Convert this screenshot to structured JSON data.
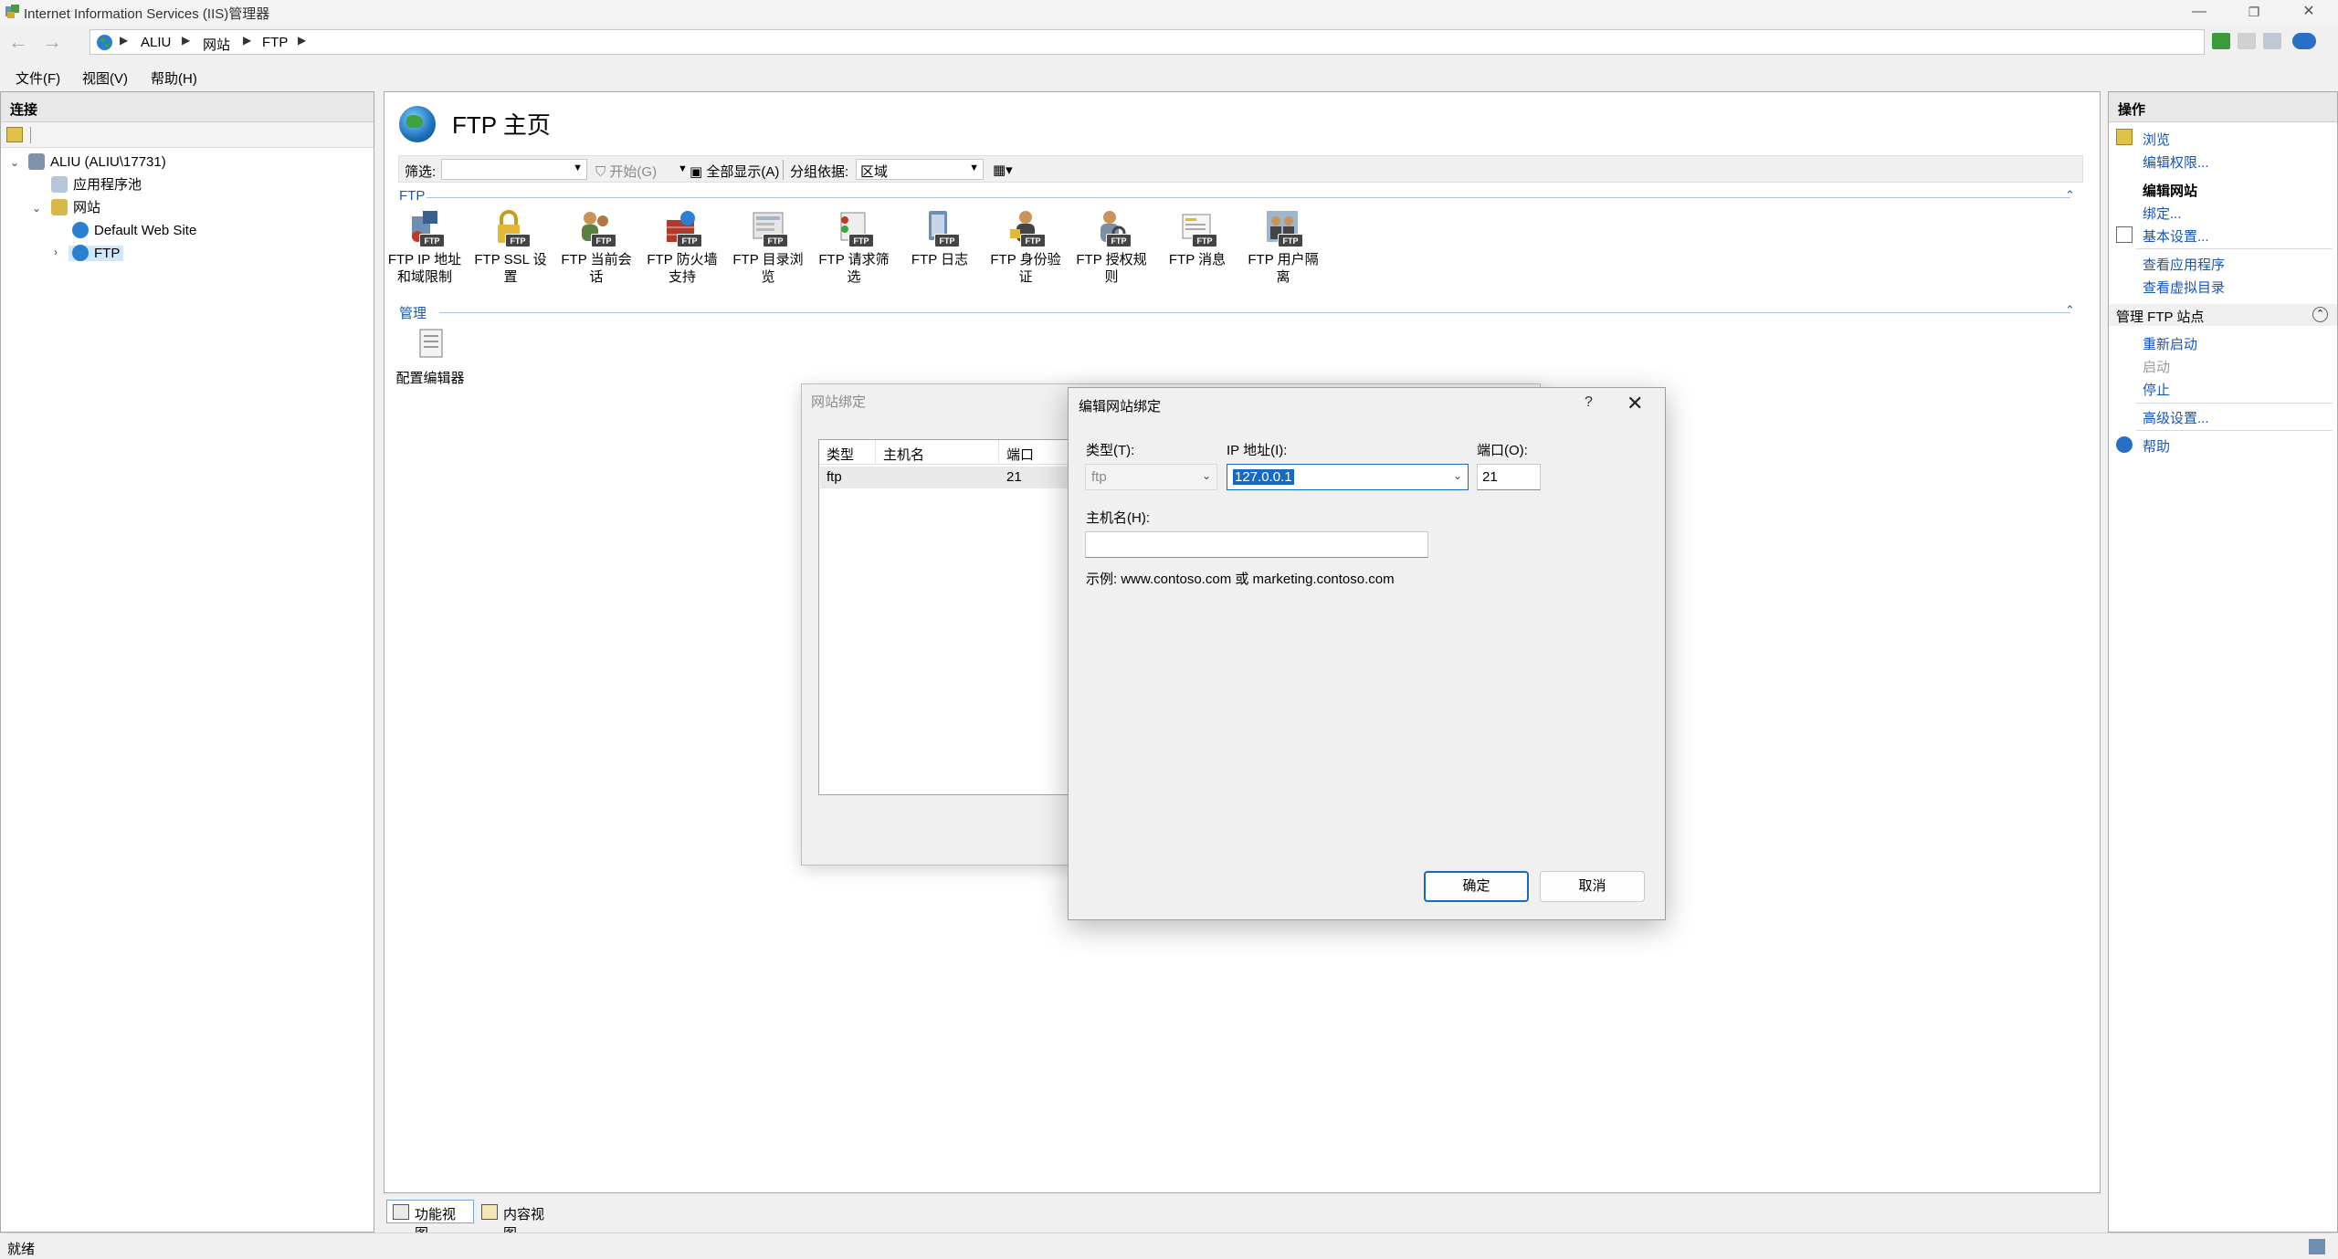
{
  "window": {
    "title": "Internet Information Services (IIS)管理器",
    "minimize_glyph": "—",
    "restore_glyph": "❐",
    "close_glyph": "✕"
  },
  "address": {
    "crumbs": [
      "ALIU",
      "网站",
      "FTP"
    ]
  },
  "menu": {
    "items": [
      "文件(F)",
      "视图(V)",
      "帮助(H)"
    ]
  },
  "left_panel": {
    "header": "连接",
    "tree": {
      "server": "ALIU (ALIU\\17731)",
      "app_pools": "应用程序池",
      "sites": "网站",
      "default_site": "Default Web Site",
      "ftp": "FTP"
    }
  },
  "center": {
    "title": "FTP 主页",
    "filter": {
      "label": "筛选:",
      "start": "开始(G)",
      "show_all": "全部显示(A)",
      "group_by_label": "分组依据:",
      "group_by_value": "区域"
    },
    "groups": {
      "ftp": "FTP",
      "manage": "管理"
    },
    "ftp_features": [
      {
        "line1": "FTP IP 地址",
        "line2": "和域限制"
      },
      {
        "line1": "FTP SSL 设",
        "line2": "置"
      },
      {
        "line1": "FTP 当前会",
        "line2": "话"
      },
      {
        "line1": "FTP 防火墙",
        "line2": "支持"
      },
      {
        "line1": "FTP 目录浏",
        "line2": "览"
      },
      {
        "line1": "FTP 请求筛",
        "line2": "选"
      },
      {
        "line1": "FTP 日志",
        "line2": ""
      },
      {
        "line1": "FTP 身份验",
        "line2": "证"
      },
      {
        "line1": "FTP 授权规",
        "line2": "则"
      },
      {
        "line1": "FTP 消息",
        "line2": ""
      },
      {
        "line1": "FTP 用户隔",
        "line2": "离"
      }
    ],
    "badge": "FTP",
    "manage_features": [
      {
        "label": "配置编辑器"
      }
    ],
    "tabs": {
      "features_view": "功能视图",
      "content_view": "内容视图"
    }
  },
  "right_panel": {
    "header": "操作",
    "browse": "浏览",
    "edit_permissions": "编辑权限...",
    "edit_site_header": "编辑网站",
    "bindings": "绑定...",
    "basic_settings": "基本设置...",
    "view_apps": "查看应用程序",
    "view_vdirs": "查看虚拟目录",
    "manage_ftp_header": "管理 FTP 站点",
    "restart": "重新启动",
    "start": "启动",
    "stop": "停止",
    "advanced_settings": "高级设置...",
    "help": "帮助"
  },
  "status": {
    "text": "就绪"
  },
  "site_bindings_dialog": {
    "title": "网站绑定",
    "columns": [
      "类型",
      "主机名",
      "端口"
    ],
    "rows": [
      {
        "type": "ftp",
        "host": "",
        "port": "21"
      }
    ]
  },
  "edit_binding_dialog": {
    "title": "编辑网站绑定",
    "help_glyph": "?",
    "close_glyph": "✕",
    "type_label": "类型(T):",
    "type_value": "ftp",
    "ip_label": "IP 地址(I):",
    "ip_value": "127.0.0.1",
    "port_label": "端口(O):",
    "port_value": "21",
    "host_label": "主机名(H):",
    "host_value": "",
    "example": "示例: www.contoso.com 或 marketing.contoso.com",
    "ok": "确定",
    "cancel": "取消"
  },
  "colors": {
    "accent": "#1769c4",
    "link": "#1756b5",
    "group_label": "#1e5aa8"
  }
}
